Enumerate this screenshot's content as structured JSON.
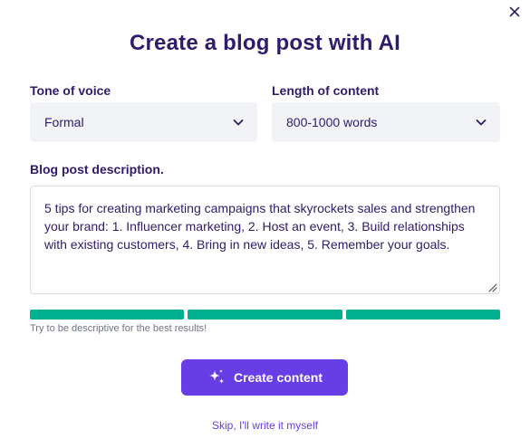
{
  "dialog": {
    "title": "Create a blog post with AI",
    "close_icon": "close-icon"
  },
  "tone": {
    "label": "Tone of voice",
    "value": "Formal",
    "icon": "chevron-down-icon"
  },
  "length": {
    "label": "Length of content",
    "value": "800-1000 words",
    "icon": "chevron-down-icon"
  },
  "description": {
    "label": "Blog post description.",
    "value": "5 tips for creating marketing campaigns that skyrockets sales and strengthen your brand: 1. Influencer marketing, 2. Host an event, 3. Build relationships with existing customers, 4. Bring in new ideas, 5. Remember your goals."
  },
  "quality_meter": {
    "filled_segments": 3,
    "total_segments": 3,
    "color": "#00b090",
    "hint": "Try to be descriptive for the best results!"
  },
  "actions": {
    "create_label": "Create content",
    "create_icon": "sparkles-icon",
    "skip_label": "Skip, I'll write it myself"
  },
  "colors": {
    "primary": "#673de6",
    "heading": "#2f1c6a",
    "success": "#00b090",
    "field_bg": "#f2f3f6"
  }
}
